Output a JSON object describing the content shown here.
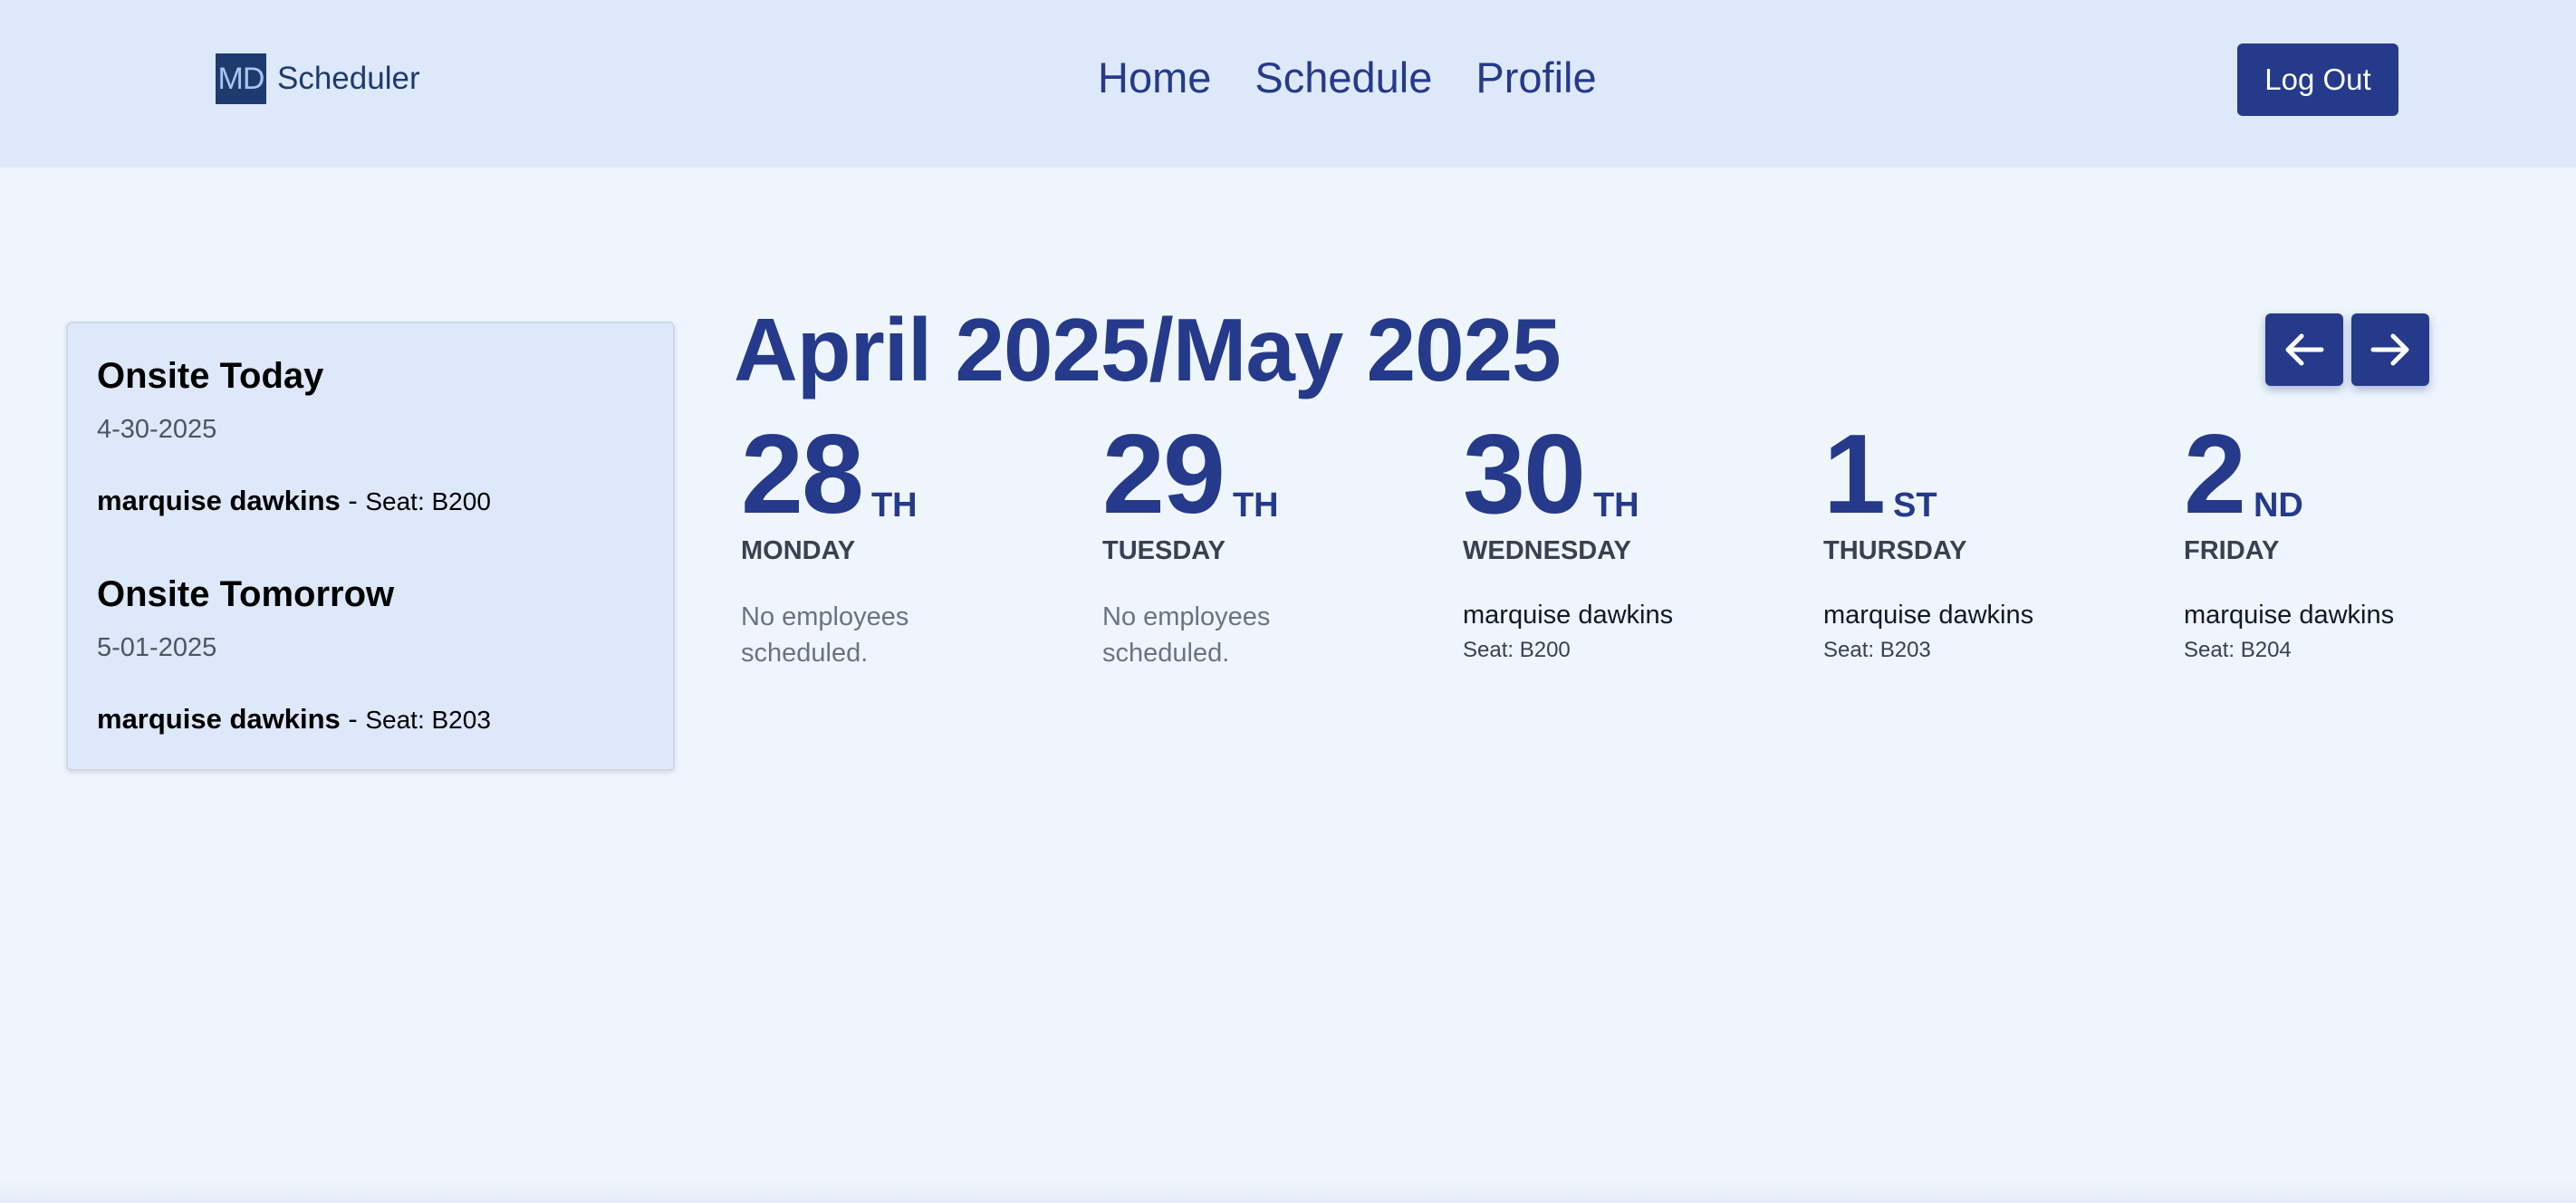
{
  "header": {
    "logo_text": "MD",
    "app_name": "Scheduler",
    "nav": [
      "Home",
      "Schedule",
      "Profile"
    ],
    "logout_label": "Log Out"
  },
  "onsite": {
    "today": {
      "title": "Onsite Today",
      "date": "4-30-2025",
      "name": "marquise dawkins",
      "separator": " - ",
      "seat": "Seat: B200"
    },
    "tomorrow": {
      "title": "Onsite Tomorrow",
      "date": "5-01-2025",
      "name": "marquise dawkins",
      "separator": " - ",
      "seat": "Seat: B203"
    }
  },
  "calendar": {
    "title": "April 2025/May 2025",
    "prev_icon": "arrow-left-icon",
    "next_icon": "arrow-right-icon",
    "days": [
      {
        "num": "28",
        "suffix": "TH",
        "weekday": "MONDAY",
        "empty": "No employees scheduled."
      },
      {
        "num": "29",
        "suffix": "TH",
        "weekday": "TUESDAY",
        "empty": "No employees scheduled."
      },
      {
        "num": "30",
        "suffix": "TH",
        "weekday": "WEDNESDAY",
        "employee": "marquise dawkins",
        "seat": "Seat: B200"
      },
      {
        "num": "1",
        "suffix": "ST",
        "weekday": "THURSDAY",
        "employee": "marquise dawkins",
        "seat": "Seat: B203"
      },
      {
        "num": "2",
        "suffix": "ND",
        "weekday": "FRIDAY",
        "employee": "marquise dawkins",
        "seat": "Seat: B204"
      }
    ]
  },
  "colors": {
    "primary": "#253a8a",
    "header_bg": "#dde8fa",
    "page_bg": "#eef5fd"
  }
}
